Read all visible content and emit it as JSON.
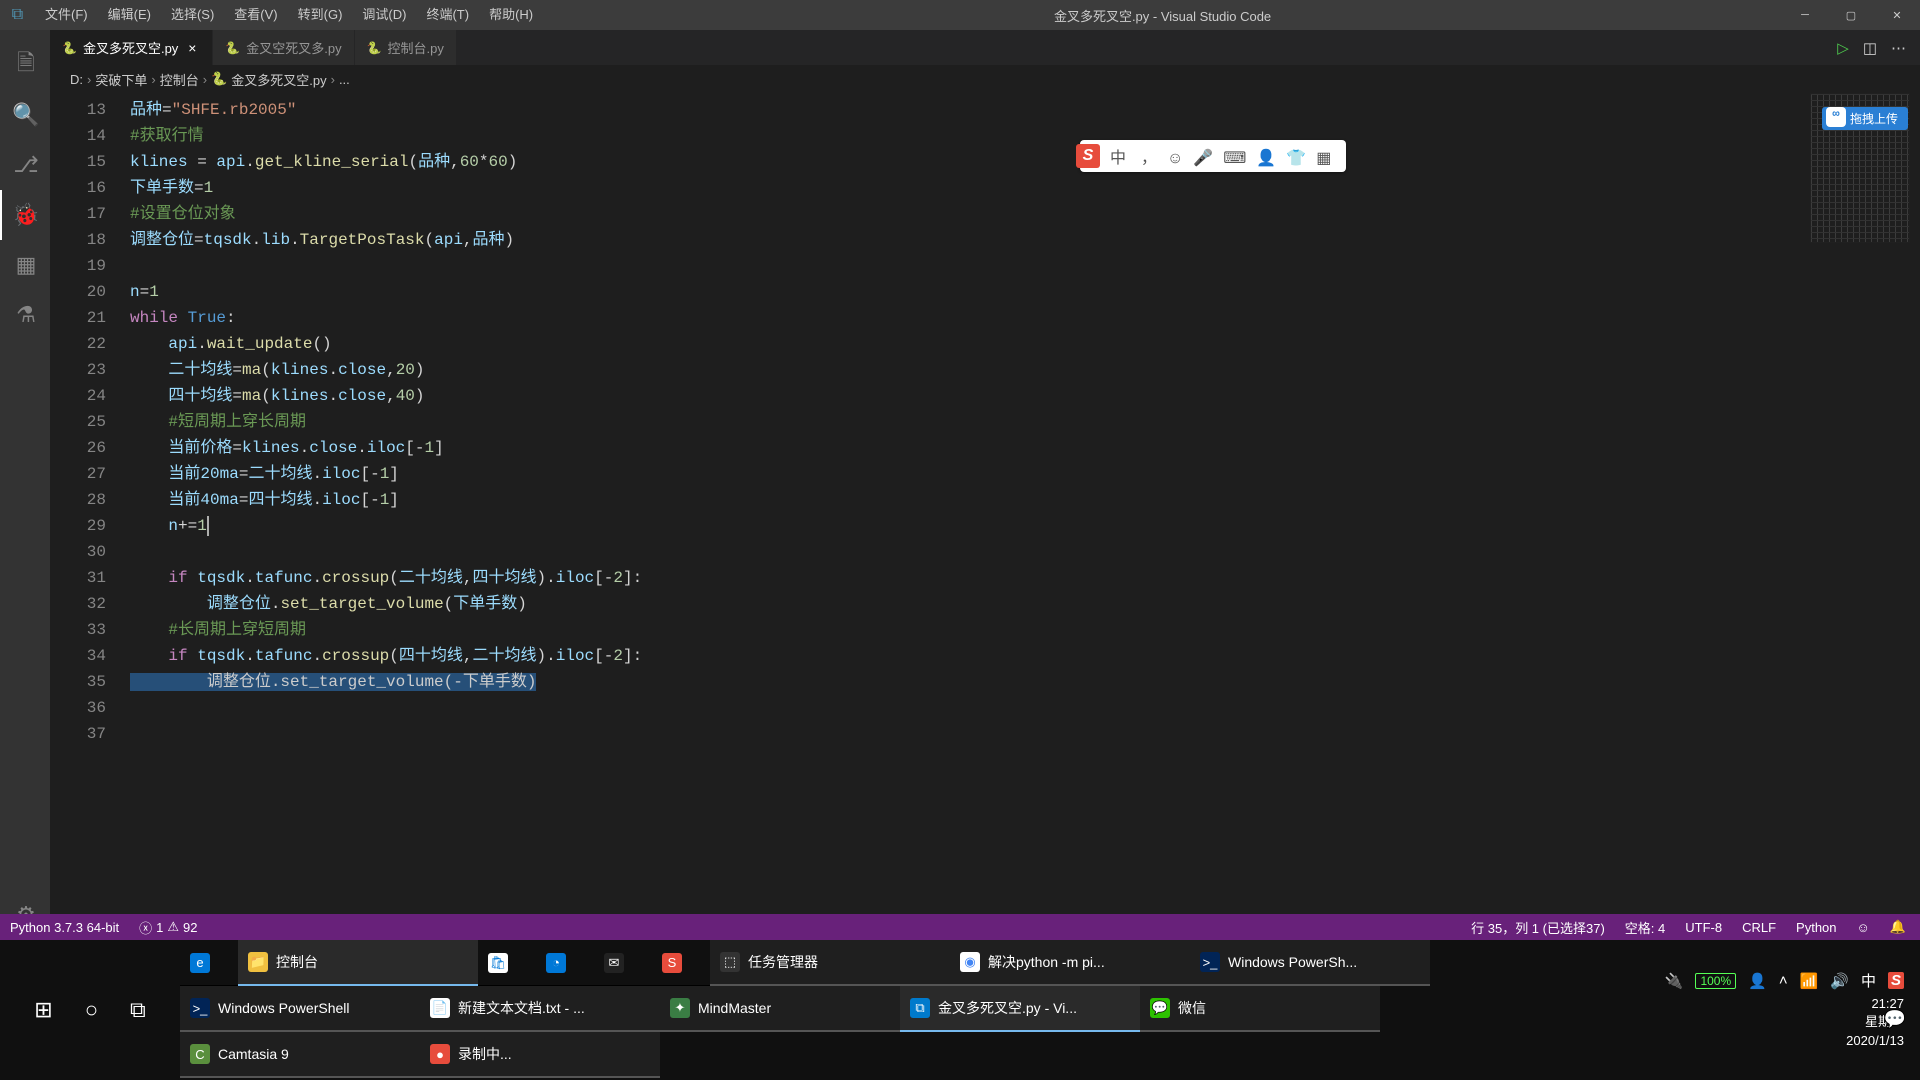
{
  "window": {
    "title": "金叉多死叉空.py - Visual Studio Code",
    "menus": [
      "文件(F)",
      "编辑(E)",
      "选择(S)",
      "查看(V)",
      "转到(G)",
      "调试(D)",
      "终端(T)",
      "帮助(H)"
    ]
  },
  "tabs": [
    {
      "icon": "py",
      "label": "金叉多死叉空.py",
      "active": true,
      "close": "×"
    },
    {
      "icon": "py",
      "label": "金叉空死叉多.py",
      "active": false,
      "close": ""
    },
    {
      "icon": "py",
      "label": "控制台.py",
      "active": false,
      "close": ""
    }
  ],
  "breadcrumb": {
    "parts": [
      "D:",
      "突破下单",
      "控制台",
      "金叉多死叉空.py",
      "..."
    ]
  },
  "gutter_start": 13,
  "code": [
    [
      [
        "var",
        "品种"
      ],
      [
        "op",
        "="
      ],
      [
        "str",
        "\"SHFE.rb2005\""
      ]
    ],
    [
      [
        "com",
        "#获取行情"
      ]
    ],
    [
      [
        "var",
        "klines"
      ],
      [
        "op",
        " = "
      ],
      [
        "prop",
        "api"
      ],
      [
        "op",
        "."
      ],
      [
        "fn",
        "get_kline_serial"
      ],
      [
        "op",
        "("
      ],
      [
        "var",
        "品种"
      ],
      [
        "op",
        ","
      ],
      [
        "num",
        "60"
      ],
      [
        "op",
        "*"
      ],
      [
        "num",
        "60"
      ],
      [
        "op",
        ")"
      ]
    ],
    [
      [
        "var",
        "下单手数"
      ],
      [
        "op",
        "="
      ],
      [
        "num",
        "1"
      ]
    ],
    [
      [
        "com",
        "#设置仓位对象"
      ]
    ],
    [
      [
        "var",
        "调整仓位"
      ],
      [
        "op",
        "="
      ],
      [
        "prop",
        "tqsdk"
      ],
      [
        "op",
        "."
      ],
      [
        "prop",
        "lib"
      ],
      [
        "op",
        "."
      ],
      [
        "fn",
        "TargetPosTask"
      ],
      [
        "op",
        "("
      ],
      [
        "var",
        "api"
      ],
      [
        "op",
        ","
      ],
      [
        "var",
        "品种"
      ],
      [
        "op",
        ")"
      ]
    ],
    [],
    [
      [
        "var",
        "n"
      ],
      [
        "op",
        "="
      ],
      [
        "num",
        "1"
      ]
    ],
    [
      [
        "kw",
        "while"
      ],
      [
        "op",
        " "
      ],
      [
        "bool",
        "True"
      ],
      [
        "op",
        ":"
      ]
    ],
    [
      [
        "op",
        "    "
      ],
      [
        "prop",
        "api"
      ],
      [
        "op",
        "."
      ],
      [
        "fn",
        "wait_update"
      ],
      [
        "op",
        "()"
      ]
    ],
    [
      [
        "op",
        "    "
      ],
      [
        "var",
        "二十均线"
      ],
      [
        "op",
        "="
      ],
      [
        "fn",
        "ma"
      ],
      [
        "op",
        "("
      ],
      [
        "prop",
        "klines"
      ],
      [
        "op",
        "."
      ],
      [
        "prop",
        "close"
      ],
      [
        "op",
        ","
      ],
      [
        "num",
        "20"
      ],
      [
        "op",
        ")"
      ]
    ],
    [
      [
        "op",
        "    "
      ],
      [
        "var",
        "四十均线"
      ],
      [
        "op",
        "="
      ],
      [
        "fn",
        "ma"
      ],
      [
        "op",
        "("
      ],
      [
        "prop",
        "klines"
      ],
      [
        "op",
        "."
      ],
      [
        "prop",
        "close"
      ],
      [
        "op",
        ","
      ],
      [
        "num",
        "40"
      ],
      [
        "op",
        ")"
      ]
    ],
    [
      [
        "op",
        "    "
      ],
      [
        "com",
        "#短周期上穿长周期"
      ]
    ],
    [
      [
        "op",
        "    "
      ],
      [
        "var",
        "当前价格"
      ],
      [
        "op",
        "="
      ],
      [
        "prop",
        "klines"
      ],
      [
        "op",
        "."
      ],
      [
        "prop",
        "close"
      ],
      [
        "op",
        "."
      ],
      [
        "prop",
        "iloc"
      ],
      [
        "op",
        "["
      ],
      [
        "op",
        "-"
      ],
      [
        "num",
        "1"
      ],
      [
        "op",
        "]"
      ]
    ],
    [
      [
        "op",
        "    "
      ],
      [
        "var",
        "当前20ma"
      ],
      [
        "op",
        "="
      ],
      [
        "var",
        "二十均线"
      ],
      [
        "op",
        "."
      ],
      [
        "prop",
        "iloc"
      ],
      [
        "op",
        "["
      ],
      [
        "op",
        "-"
      ],
      [
        "num",
        "1"
      ],
      [
        "op",
        "]"
      ]
    ],
    [
      [
        "op",
        "    "
      ],
      [
        "var",
        "当前40ma"
      ],
      [
        "op",
        "="
      ],
      [
        "var",
        "四十均线"
      ],
      [
        "op",
        "."
      ],
      [
        "prop",
        "iloc"
      ],
      [
        "op",
        "["
      ],
      [
        "op",
        "-"
      ],
      [
        "num",
        "1"
      ],
      [
        "op",
        "]"
      ]
    ],
    [
      [
        "op",
        "    "
      ],
      [
        "var",
        "n"
      ],
      [
        "op",
        "+="
      ],
      [
        "num",
        "1"
      ]
    ],
    [],
    [
      [
        "op",
        "    "
      ],
      [
        "kw",
        "if"
      ],
      [
        "op",
        " "
      ],
      [
        "prop",
        "tqsdk"
      ],
      [
        "op",
        "."
      ],
      [
        "prop",
        "tafunc"
      ],
      [
        "op",
        "."
      ],
      [
        "fn",
        "crossup"
      ],
      [
        "op",
        "("
      ],
      [
        "var",
        "二十均线"
      ],
      [
        "op",
        ","
      ],
      [
        "var",
        "四十均线"
      ],
      [
        "op",
        ")."
      ],
      [
        "prop",
        "iloc"
      ],
      [
        "op",
        "["
      ],
      [
        "op",
        "-"
      ],
      [
        "num",
        "2"
      ],
      [
        "op",
        "]:"
      ]
    ],
    [
      [
        "op",
        "        "
      ],
      [
        "var",
        "调整仓位"
      ],
      [
        "op",
        "."
      ],
      [
        "fn",
        "set_target_volume"
      ],
      [
        "op",
        "("
      ],
      [
        "var",
        "下单手数"
      ],
      [
        "op",
        ")"
      ]
    ],
    [
      [
        "op",
        "    "
      ],
      [
        "com",
        "#长周期上穿短周期"
      ]
    ],
    [
      [
        "op",
        "    "
      ],
      [
        "kw",
        "if"
      ],
      [
        "op",
        " "
      ],
      [
        "prop",
        "tqsdk"
      ],
      [
        "op",
        "."
      ],
      [
        "prop",
        "tafunc"
      ],
      [
        "op",
        "."
      ],
      [
        "fn",
        "crossup"
      ],
      [
        "op",
        "("
      ],
      [
        "var",
        "四十均线"
      ],
      [
        "op",
        ","
      ],
      [
        "var",
        "二十均线"
      ],
      [
        "op",
        ")."
      ],
      [
        "prop",
        "iloc"
      ],
      [
        "op",
        "["
      ],
      [
        "op",
        "-"
      ],
      [
        "num",
        "2"
      ],
      [
        "op",
        "]:"
      ]
    ],
    [
      [
        "sel",
        "        调整仓位.set_target_volume(-下单手数)"
      ]
    ],
    [],
    []
  ],
  "selected_line_index": 22,
  "cursor_line": 16,
  "ime": {
    "lang": "中",
    "icons": [
      "，",
      "☺",
      "🎤",
      "⌨",
      "👤",
      "👕",
      "▦"
    ]
  },
  "upload_label": "拖拽上传",
  "statusbar": {
    "python": "Python 3.7.3 64-bit",
    "errors": "1",
    "warnings": "92",
    "position": "行 35，列 1 (已选择37)",
    "spaces": "空格: 4",
    "encoding": "UTF-8",
    "eol": "CRLF",
    "lang": "Python",
    "feedback": "☺",
    "bell": "🔔"
  },
  "taskbar": {
    "row1": [
      {
        "ic": "ic-edge",
        "glyph": "e",
        "label": ""
      },
      {
        "ic": "ic-folder",
        "glyph": "📁",
        "label": "控制台",
        "cls": "active"
      },
      {
        "ic": "ic-store",
        "glyph": "🛍",
        "label": ""
      },
      {
        "ic": "ic-clock",
        "glyph": "◔",
        "label": ""
      },
      {
        "ic": "ic-mail",
        "glyph": "✉",
        "label": ""
      },
      {
        "ic": "ic-sogou",
        "glyph": "S",
        "label": ""
      },
      {
        "ic": "ic-task",
        "glyph": "⬚",
        "label": "任务管理器",
        "cls": "running"
      },
      {
        "ic": "ic-chrome",
        "glyph": "◉",
        "label": "解决python -m pi...",
        "cls": "running"
      },
      {
        "ic": "ic-ps",
        "glyph": ">_",
        "label": "Windows PowerSh...",
        "cls": "running"
      }
    ],
    "row2": [
      {
        "ic": "ic-ps",
        "glyph": ">_",
        "label": "Windows PowerShell",
        "cls": "running"
      },
      {
        "ic": "ic-note",
        "glyph": "📄",
        "label": "新建文本文档.txt - ...",
        "cls": "running"
      },
      {
        "ic": "ic-mind",
        "glyph": "✦",
        "label": "MindMaster",
        "cls": "running"
      },
      {
        "ic": "ic-vsc",
        "glyph": "⧉",
        "label": "金叉多死叉空.py - Vi...",
        "cls": "active"
      },
      {
        "ic": "ic-wechat",
        "glyph": "💬",
        "label": "微信",
        "cls": "running"
      }
    ],
    "row3": [
      {
        "ic": "ic-camt",
        "glyph": "C",
        "label": "Camtasia 9",
        "cls": "running"
      },
      {
        "ic": "ic-rec",
        "glyph": "●",
        "label": "录制中...",
        "cls": "running"
      }
    ],
    "battery": "100%",
    "clock_time": "21:27",
    "clock_day": "星期一",
    "clock_date": "2020/1/13"
  }
}
